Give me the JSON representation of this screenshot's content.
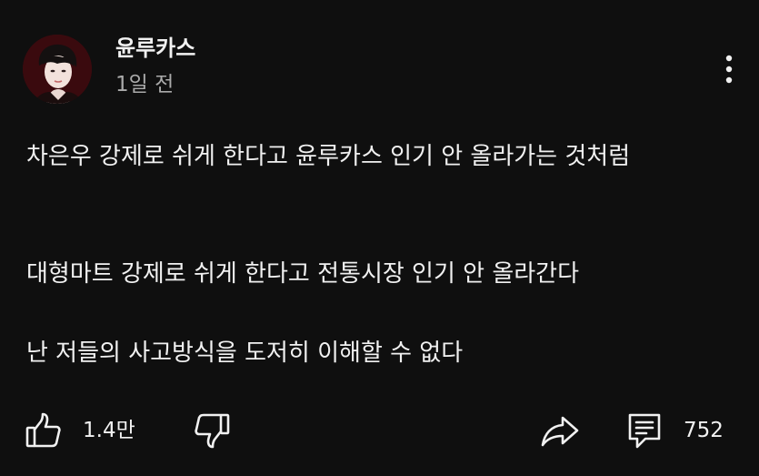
{
  "post": {
    "author": "윤루카스",
    "time": "1일 전",
    "paragraphs": [
      "차은우 강제로 쉬게 한다고 윤루카스 인기 안 올라가는 것처럼",
      "대형마트 강제로 쉬게 한다고 전통시장 인기 안 올라간다",
      "난 저들의 사고방식을 도저히 이해할 수 없다"
    ]
  },
  "actions": {
    "like_count": "1.4만",
    "reply_count": "752"
  },
  "icons": {
    "like": "thumbs-up-icon",
    "dislike": "thumbs-down-icon",
    "share": "share-icon",
    "comment": "comment-icon",
    "menu": "more-vertical-icon"
  }
}
